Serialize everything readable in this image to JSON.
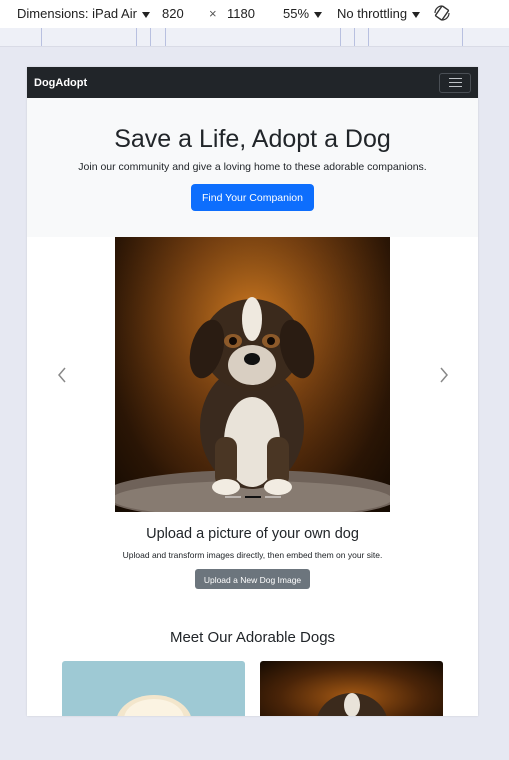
{
  "devtools": {
    "device_label": "Dimensions: iPad Air",
    "width": "820",
    "times": "×",
    "height": "1180",
    "zoom": "55%",
    "throttling": "No throttling"
  },
  "navbar": {
    "brand": "DogAdopt"
  },
  "hero": {
    "title": "Save a Life, Adopt a Dog",
    "subtitle": "Join our community and give a loving home to these adorable companions.",
    "cta": "Find Your Companion"
  },
  "carousel": {
    "caption_title": "Upload a picture of your own dog",
    "caption_text": "Upload and transform images directly, then embed them on your site.",
    "upload_button": "Upload a New Dog Image",
    "indicator_count": 3,
    "active_indicator": 1
  },
  "gallery": {
    "title": "Meet Our Adorable Dogs"
  },
  "colors": {
    "navbar": "#212529",
    "primary": "#0d6efd",
    "secondary": "#6c757d",
    "hero_bg": "#f8f9fa"
  }
}
